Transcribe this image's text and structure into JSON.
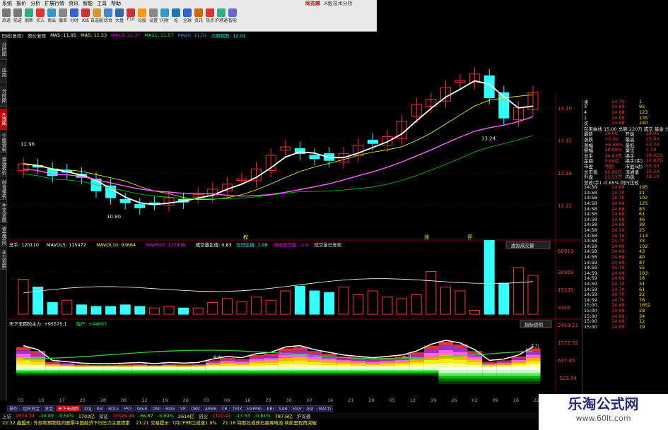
{
  "menu": {
    "items": [
      "系统",
      "报价",
      "分析",
      "扩展行情",
      "资讯",
      "智能",
      "工具",
      "帮助"
    ],
    "brand": "同花顺",
    "subtitle": "A股技术分析"
  },
  "toolbar": {
    "items": [
      {
        "label": "后退",
        "color": "#777"
      },
      {
        "label": "前进",
        "color": "#777"
      },
      {
        "label": "刷新",
        "color": "#3a8"
      },
      {
        "label": "买入",
        "color": "#d33"
      },
      {
        "label": "卖出",
        "color": "#39c"
      },
      {
        "label": "撤单",
        "color": "#888"
      },
      {
        "label": "分时",
        "color": "#36c"
      },
      {
        "label": "K线",
        "color": "#c33"
      },
      {
        "label": "自选股",
        "color": "#c93"
      },
      {
        "label": "综合",
        "color": "#48c"
      },
      {
        "label": "大盘",
        "color": "#36a"
      },
      {
        "label": "F10",
        "color": "#c33"
      },
      {
        "label": "论股",
        "color": "#f90"
      },
      {
        "label": "设置",
        "color": "#888"
      },
      {
        "label": "问财",
        "color": "#39c"
      },
      {
        "label": "论",
        "color": "#27a"
      },
      {
        "label": "全球",
        "color": "#36c"
      },
      {
        "label": "资讯",
        "color": "#c60"
      },
      {
        "label": "热点",
        "color": "#d33"
      },
      {
        "label": "沪港通",
        "color": "#3a8"
      },
      {
        "label": "智能",
        "color": "#66c"
      }
    ]
  },
  "infobar": [
    {
      "text": "日线(复权)",
      "color": "#ddd"
    },
    {
      "text": "原价复原",
      "color": "#ddd"
    },
    {
      "text": "MA5: 11.95",
      "color": "#fff"
    },
    {
      "text": "MA5: 11.53",
      "color": "#ff0"
    },
    {
      "text": "MA13: 11.37",
      "color": "#f0f"
    },
    {
      "text": "MA21: 11.57",
      "color": "#0f0"
    },
    {
      "text": "MA20: 11.51",
      "color": "#39f"
    },
    {
      "text": "大阴买阶: 12.01",
      "color": "#0ff"
    }
  ],
  "vtabs": [
    {
      "label": "分时图",
      "active": false
    },
    {
      "label": "应用",
      "active": false
    },
    {
      "label": "分时图",
      "active": false
    },
    {
      "label": "K线图",
      "active": true
    },
    {
      "label": "个股资料",
      "active": false
    },
    {
      "label": "自选报价",
      "active": false
    },
    {
      "label": "综合排名",
      "active": false
    },
    {
      "label": "牛叉诊股",
      "active": false
    },
    {
      "label": "资金流向",
      "active": false
    },
    {
      "label": "主力追踪",
      "active": false
    }
  ],
  "kchart": {
    "price_ticks": [
      "14.10",
      "13.15",
      "12.18",
      "11.23"
    ],
    "annotations": {
      "high": "12.96",
      "low": "10.80",
      "right_low": "13.24"
    },
    "flags": [
      "权",
      "涨",
      "停"
    ]
  },
  "vol": {
    "header": [
      {
        "text": "总手: 120110",
        "color": "#fff"
      },
      {
        "text": "MAVOL5: 115472",
        "color": "#fff"
      },
      {
        "text": "MAVOL10: 93664",
        "color": "#ff0"
      },
      {
        "text": "MAVOL5: 127418",
        "color": "#f0f"
      },
      {
        "text": "成交量比值: 0.83",
        "color": "#fff"
      },
      {
        "text": "五日比值: 1.08",
        "color": "#0ff"
      },
      {
        "text": "持续成交量: -1.0",
        "color": "#f0f"
      },
      {
        "text": "成交量已复权",
        "color": "#ddd"
      }
    ],
    "ticks": [
      "60918",
      "30959",
      "15330",
      "3310"
    ],
    "btn": "虚拟成交量"
  },
  "ind": {
    "header": [
      {
        "text": "天下无四阶",
        "color": "#fff"
      },
      {
        "text": "主力: +95575.1",
        "color": "#fff"
      },
      {
        "text": "散户: +44897",
        "color": "#0f0"
      }
    ],
    "ticks": [
      "2414.21",
      "1572.52",
      "637.85",
      "-523.54"
    ],
    "btn": "指标说明",
    "labels": {
      "l1": "主力",
      "l2": "主力",
      "l3": "主力"
    }
  },
  "xaxis": [
    "03",
    "10",
    "17",
    "20",
    "28",
    "06",
    "12",
    "19",
    "26",
    "03",
    "09",
    "16",
    "23",
    "30",
    "07",
    "14",
    "21",
    "28",
    "05",
    "12",
    "19",
    "26",
    "02",
    "09",
    "16",
    "22"
  ],
  "right": {
    "top": [
      {
        "a": "卖",
        "b": "14.70",
        "c": "1",
        "cls": "red"
      },
      {
        "a": "3",
        "b": "14.69",
        "c": "95",
        "cls": "red"
      },
      {
        "a": "4",
        "b": "14.68",
        "c": "123",
        "cls": "red"
      },
      {
        "a": "1",
        "b": "14.69",
        "c": "135",
        "cls": "red"
      },
      {
        "a": "买",
        "b": "14.68",
        "c": "240",
        "cls": "red"
      }
    ],
    "title": "在来曲线 15.00 总额   220万   成交  基金  分权",
    "mid": [
      {
        "a": "最新",
        "b": "14.69",
        "c": "开盘",
        "d": "14.05"
      },
      {
        "a": "涨跌",
        "b": "+0.92",
        "c": "最高",
        "d": "15.00"
      },
      {
        "a": "涨幅",
        "b": "+6.68%",
        "c": "最低",
        "d": "13.70"
      },
      {
        "a": "振幅",
        "b": "10.89%",
        "c": "量比",
        "d": "1.10"
      },
      {
        "a": "总手",
        "b": "39.63万",
        "c": "换手",
        "d": "18.42%"
      },
      {
        "a": "金额",
        "b": "5.69亿",
        "c": "换手(实)",
        "d": "12.83%"
      },
      {
        "a": "市盈",
        "b": "亏损",
        "c": "市盈(动)",
        "d": "55.30"
      },
      {
        "a": "总市值",
        "b": "55.85亿",
        "c": "流通值",
        "d": "16.20"
      },
      {
        "a": "外盘",
        "b": "21.53万",
        "c": "内盘",
        "d": "18.10"
      }
    ],
    "sect": "营收(手)   -0.85%   同行比较",
    "ticks": [
      {
        "t": "14:58",
        "p": "14.69",
        "v": "195"
      },
      {
        "t": "14:58",
        "p": "14.70",
        "v": "21"
      },
      {
        "t": "14:58",
        "p": "14.70",
        "v": "102"
      },
      {
        "t": "14:58",
        "p": "14.69",
        "v": "125"
      },
      {
        "t": "14:58",
        "p": "14.68",
        "v": "83"
      },
      {
        "t": "14:58",
        "p": "14.69",
        "v": "61"
      },
      {
        "t": "14:58",
        "p": "14.69",
        "v": "46"
      },
      {
        "t": "14:58",
        "p": "14.69",
        "v": "38"
      },
      {
        "t": "14:58",
        "p": "14.70",
        "v": "25"
      },
      {
        "t": "14:58",
        "p": "14.70",
        "v": "113"
      },
      {
        "t": "14:58",
        "p": "14.70",
        "v": "33"
      },
      {
        "t": "14:58",
        "p": "14.69",
        "v": "102"
      },
      {
        "t": "14:58",
        "p": "14.69",
        "v": "43"
      },
      {
        "t": "14:58",
        "p": "14.68",
        "v": "40"
      },
      {
        "t": "14:59",
        "p": "14.69",
        "v": "87"
      },
      {
        "t": "14:59",
        "p": "14.70",
        "v": "55"
      },
      {
        "t": "14:59",
        "p": "14.69",
        "v": "103"
      },
      {
        "t": "14:59",
        "p": "14.69",
        "v": "18"
      },
      {
        "t": "14:59",
        "p": "14.70",
        "v": "31"
      },
      {
        "t": "14:59",
        "p": "14.70",
        "v": "61"
      },
      {
        "t": "14:59",
        "p": "14.70",
        "v": "22"
      },
      {
        "t": "14:59",
        "p": "14.70",
        "v": "76"
      },
      {
        "t": "15:00",
        "p": "14.69",
        "v": "1652"
      },
      {
        "t": "15:00",
        "p": "14.69",
        "v": "28"
      },
      {
        "t": "15:00",
        "p": "14.69",
        "v": "34"
      },
      {
        "t": "15:00",
        "p": "14.69",
        "v": "12"
      },
      {
        "t": "15:00",
        "p": "14.69",
        "v": "19"
      }
    ]
  },
  "indtabs": [
    {
      "label": "操作",
      "on": false
    },
    {
      "label": "组织资金",
      "on": false
    },
    {
      "label": "资金",
      "on": false
    },
    {
      "label": "天下无四阶",
      "on": true
    },
    {
      "label": "KDJ",
      "on": false
    },
    {
      "label": "RSI",
      "on": false
    },
    {
      "label": "BOLL",
      "on": false
    },
    {
      "label": "PSY",
      "on": false
    },
    {
      "label": "W&R",
      "on": false
    },
    {
      "label": "DMI",
      "on": false
    },
    {
      "label": "BIAS",
      "on": false
    },
    {
      "label": "VR",
      "on": false
    },
    {
      "label": "OBV",
      "on": false
    },
    {
      "label": "ARBR",
      "on": false
    },
    {
      "label": "CR",
      "on": false
    },
    {
      "label": "TRIX",
      "on": false
    },
    {
      "label": "EXPMA",
      "on": false
    },
    {
      "label": "BBI",
      "on": false
    },
    {
      "label": "SAR",
      "on": false
    },
    {
      "label": "EMV",
      "on": false
    },
    {
      "label": "ASI",
      "on": false
    },
    {
      "label": "MACD",
      "on": false
    }
  ],
  "status": [
    {
      "text": "上证",
      "color": "#ccc"
    },
    {
      "text": "2979.34",
      "color": "#f33"
    },
    {
      "text": "-14.99",
      "color": "#0f0"
    },
    {
      "text": "-0.50%",
      "color": "#0f0"
    },
    {
      "text": "1702亿",
      "color": "#ff0"
    },
    {
      "text": "深证",
      "color": "#ccc"
    },
    {
      "text": "10329.44",
      "color": "#f33"
    },
    {
      "text": "-66.87",
      "color": "#0f0"
    },
    {
      "text": "-0.64%",
      "color": "#0f0"
    },
    {
      "text": "2614亿",
      "color": "#ff0"
    },
    {
      "text": "创业",
      "color": "#ccc"
    },
    {
      "text": "2122.41",
      "color": "#f33"
    },
    {
      "text": "-17.33",
      "color": "#0f0"
    },
    {
      "text": "-0.81%",
      "color": "#0f0"
    },
    {
      "text": "787.6亿",
      "color": "#ff0"
    },
    {
      "text": "沪深通",
      "color": "#ccc"
    }
  ],
  "news": [
    {
      "text": "22:32 鑫盟夫: 外部和期物性同股票中国经济下行压力主要因素",
      "color": "#ff0"
    },
    {
      "text": "21:21 交易提示: 7月CPI环比或涨1.9%",
      "color": "#ff0"
    },
    {
      "text": "21:16 特斯拉或获石墨烯电池 续航里程再突破",
      "color": "#ff0"
    }
  ],
  "watermark": {
    "title": "乐淘公式网",
    "url": "www.60lt.com"
  }
}
